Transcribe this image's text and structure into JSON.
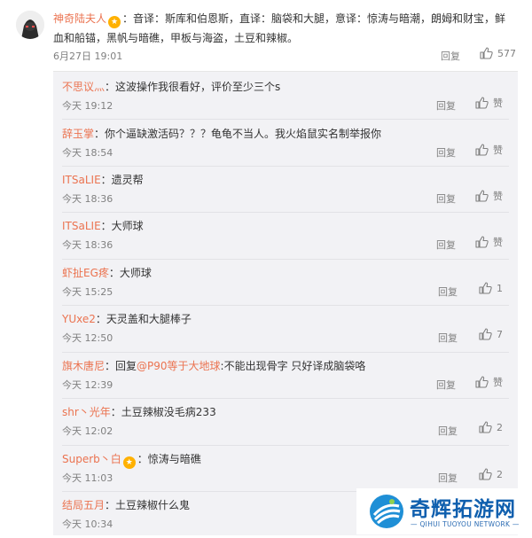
{
  "main_comment": {
    "username": "神奇陆夫人",
    "text": "：音译：斯库和伯恩斯，直译：脑袋和大腿，意译：惊涛与暗潮，朗姆和财宝，鲜血和船锚，黑帆与暗礁，甲板与海盗，土豆和辣椒。",
    "time": "6月27日 19:01",
    "reply_label": "回复",
    "likes": "577"
  },
  "replies": [
    {
      "user": "不思议灬",
      "text": "：这波操作我很看好，评价至少三个s",
      "time": "今天 19:12",
      "reply_label": "回复",
      "likes": "赞"
    },
    {
      "user": "辞玉掌",
      "text": "：你个逼缺激活码？？？龟龟不当人。我火焰鼠实名制举报你",
      "time": "今天 18:54",
      "reply_label": "回复",
      "likes": "赞"
    },
    {
      "user": "ITSaLIE",
      "text": "：遗灵帮",
      "time": "今天 18:36",
      "reply_label": "回复",
      "likes": "赞"
    },
    {
      "user": "ITSaLIE",
      "text": "：大师球",
      "time": "今天 18:36",
      "reply_label": "回复",
      "likes": "赞"
    },
    {
      "user": "虾扯EG疼",
      "text": "：大师球",
      "time": "今天 15:25",
      "reply_label": "回复",
      "likes": "1"
    },
    {
      "user": "YUxe2",
      "text": "：天灵盖和大腿棒子",
      "time": "今天 12:50",
      "reply_label": "回复",
      "likes": "7"
    },
    {
      "user": "旗木唐尼",
      "text_prefix": "：回复",
      "mention": "@P90等于大地球",
      "text_suffix": ":不能出现骨字 只好译成脑袋咯",
      "time": "今天 12:39",
      "reply_label": "回复",
      "likes": "赞"
    },
    {
      "user": "shr丶光年",
      "text": "：土豆辣椒没毛病233",
      "time": "今天 12:02",
      "reply_label": "回复",
      "likes": "2"
    },
    {
      "user": "Superb丶白",
      "text": "：惊涛与暗礁",
      "time": "今天 11:03",
      "reply_label": "回复",
      "likes": "2"
    },
    {
      "user": "结局五月",
      "text": "：土豆辣椒什么鬼",
      "time": "今天 10:34",
      "reply_label": "回复",
      "likes": ""
    }
  ],
  "watermark": {
    "title": "奇辉拓游网",
    "subtitle": "— QIHUI TUOYOU NETWORK —"
  },
  "colors": {
    "username": "#eb7350",
    "meta": "#808080",
    "reply_bg": "#f2f2f5",
    "watermark_blue": "#0f5fae"
  }
}
